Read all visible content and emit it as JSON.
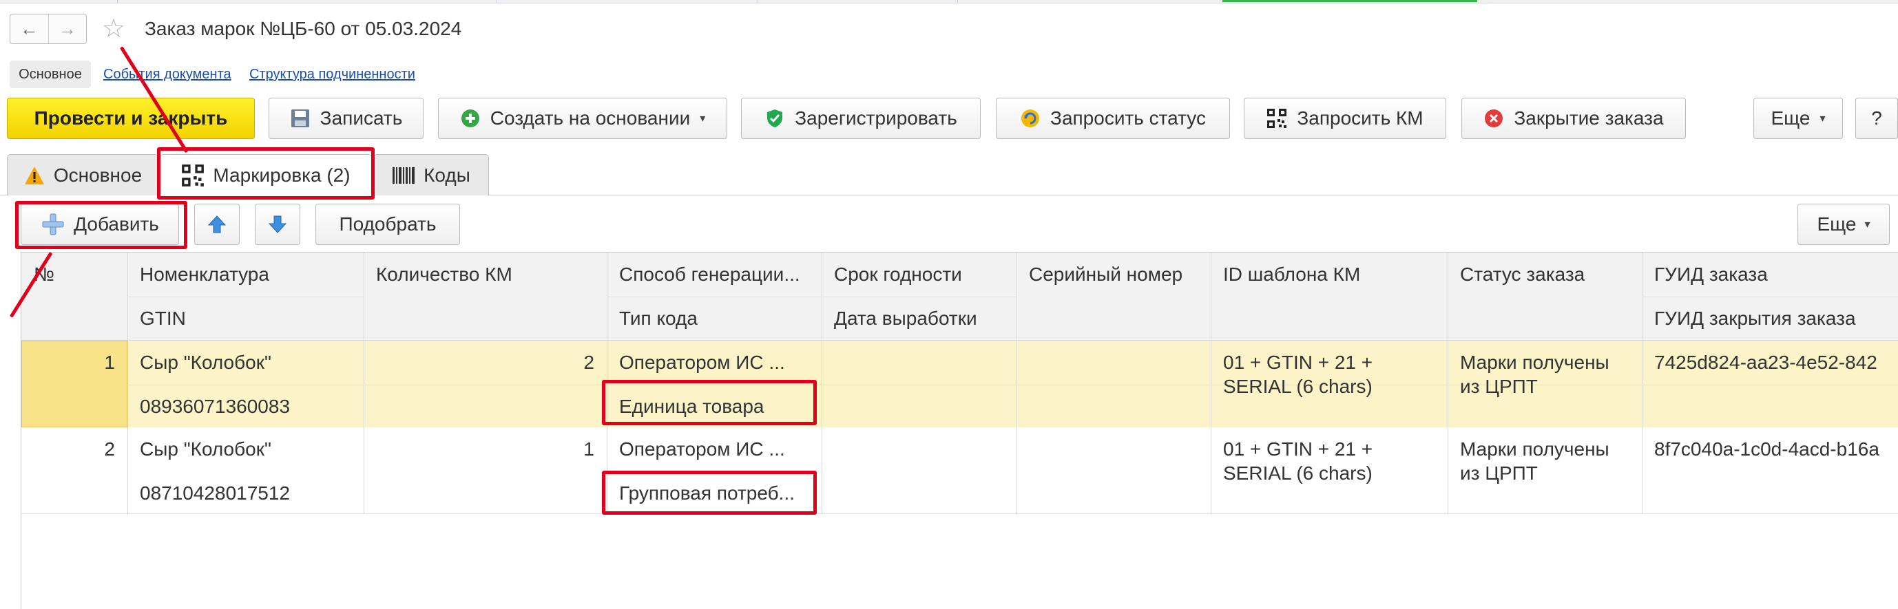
{
  "window": {
    "title": "Заказ марок №ЦБ-60 от 05.03.2024",
    "nav_back": "←",
    "nav_forward": "→",
    "favorite_glyph": "☆"
  },
  "section_tabs": [
    {
      "label": "Основное"
    },
    {
      "label": "События документа"
    },
    {
      "label": "Структура подчиненности"
    }
  ],
  "toolbar": {
    "post_close": "Провести и закрыть",
    "save": "Записать",
    "create_based": "Создать на основании",
    "register": "Зарегистрировать",
    "request_status": "Запросить статус",
    "request_km": "Запросить КМ",
    "close_order": "Закрытие заказа",
    "more": "Еще",
    "help": "?"
  },
  "tabs": [
    {
      "label": "Основное"
    },
    {
      "label": "Маркировка (2)"
    },
    {
      "label": "Коды"
    }
  ],
  "table_toolbar": {
    "add": "Добавить",
    "select": "Подобрать",
    "more": "Еще"
  },
  "table": {
    "headers_top": [
      "№",
      "Номенклатура",
      "Количество КМ",
      "Способ генерации...",
      "Срок годности",
      "Серийный номер",
      "ID шаблона КМ",
      "Статус заказа",
      "ГУИД заказа"
    ],
    "headers_bottom": [
      "",
      "GTIN",
      "",
      "Тип кода",
      "Дата выработки",
      "",
      "",
      "",
      "ГУИД закрытия заказа"
    ],
    "rows": [
      {
        "num": "1",
        "name": "Сыр \"Колобок\"",
        "gtin": "08936071360083",
        "qty": "2",
        "gen_method": "Оператором ИС ...",
        "code_type": "Единица товара",
        "template_id_1": "01 + GTIN + 21 +",
        "template_id_2": "SERIAL (6 chars)",
        "status_1": "Марки получены",
        "status_2": "из ЦРПТ",
        "guid": "7425d824-aa23-4e52-842"
      },
      {
        "num": "2",
        "name": "Сыр \"Колобок\"",
        "gtin": "08710428017512",
        "qty": "1",
        "gen_method": "Оператором ИС ...",
        "code_type": "Групповая потреб...",
        "template_id_1": "01 + GTIN + 21 +",
        "template_id_2": "SERIAL (6 chars)",
        "status_1": "Марки получены",
        "status_2": "из ЦРПТ",
        "guid": "8f7c040a-1c0d-4acd-b16a"
      }
    ]
  },
  "colors": {
    "accent_yellow": "#f7e000",
    "selected_row": "#fdf3c8",
    "selected_num": "#f8e28a",
    "annotation_red": "#e0001b",
    "link_blue": "#1a4fb5"
  }
}
